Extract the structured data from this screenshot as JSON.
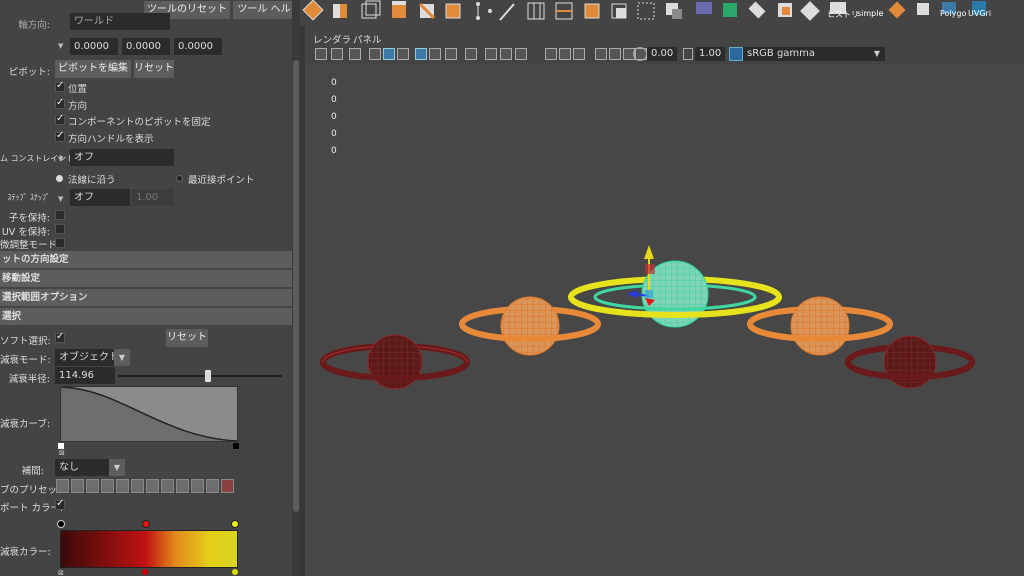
{
  "tool_header": {
    "reset_tool": "ツールのリセット",
    "tool_help": "ツール ヘルプ"
  },
  "orientation": {
    "label": "軸方向:",
    "value": "ワールド"
  },
  "axis_values": [
    "0.0000",
    "0.0000",
    "0.0000"
  ],
  "pivot": {
    "label": "ピボット:",
    "edit_button": "ピボットを編集",
    "reset_button": "リセット"
  },
  "pivot_options": [
    {
      "label": "位置",
      "checked": true
    },
    {
      "label": "方向",
      "checked": true
    },
    {
      "label": "コンポーネントのピボットを固定",
      "checked": true
    },
    {
      "label": "方向ハンドルを表示",
      "checked": true
    }
  ],
  "constraint": {
    "label": "ム コンストレイント:",
    "value": "オフ"
  },
  "radio": {
    "option1": "法線に沿う",
    "option2": "最近接ポイント"
  },
  "step_snap": {
    "label": "ｽﾃｯﾌﾟ ｽﾅｯﾌﾟ",
    "value": "オフ",
    "number": "1.00"
  },
  "keep": {
    "children": "子を保持:",
    "uv": "UV を保持:",
    "adjust": "微調整モード:"
  },
  "sections": {
    "axis_orient": "ットの方向設定",
    "move_settings": "移動設定",
    "selection_range": "選択範囲オプション",
    "soft_select": "選択"
  },
  "soft": {
    "soft_label": "ソフト選択:",
    "reset": "リセット",
    "falloff_mode_label": "減衰モード:",
    "falloff_mode": "オブジェクト",
    "radius_label": "減衰半径:",
    "radius": "114.96",
    "radius_fraction": 0.55,
    "curve_label": "減衰カーブ:",
    "interp_label": "補間:",
    "interp": "なし",
    "presets_label": "ブのプリセット:",
    "viewport_color_label": "ポート カラー:",
    "color_label": "減衰カラー:"
  },
  "toolbar_labels": {
    "history": "ヒストリ",
    "simple": "simple",
    "polygon": "Polygo",
    "uvgrid": "UVGri"
  },
  "viewport_menu": {
    "renderer": "レンダラ",
    "panels": "パネル"
  },
  "viewport_toolbar": {
    "exposure": "0.00",
    "gamma": "1.00",
    "colorspace": "sRGB gamma"
  },
  "hud_values": [
    "0",
    "0",
    "0",
    "0",
    "0"
  ],
  "colors": {
    "accent": "#3d7aa8",
    "orange": "#e08a3a",
    "wire_orange": "#e8893a",
    "wire_dark_red": "#7a1d1d",
    "wire_green": "#3fd6a0",
    "wire_yellow": "#e6e31c"
  }
}
